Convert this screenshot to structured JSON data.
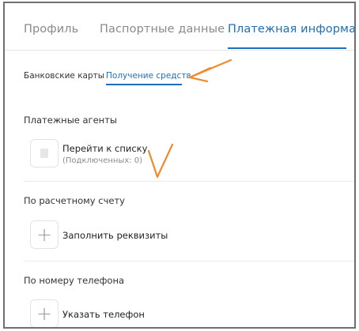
{
  "tabs": [
    {
      "label": "Профиль",
      "active": false
    },
    {
      "label": "Паспортные данные",
      "active": false
    },
    {
      "label": "Платежная информация",
      "active": true
    }
  ],
  "subtabs": [
    {
      "label": "Банковские карты",
      "active": false
    },
    {
      "label": "Получение средств",
      "active": true
    }
  ],
  "sections": {
    "agents": {
      "title": "Платежные агенты",
      "action": "Перейти к списку",
      "connected": "(Подключенных: 0)"
    },
    "account": {
      "title": "По расчетному счету",
      "action": "Заполнить реквизиты"
    },
    "phone": {
      "title": "По номеру телефона",
      "action": "Указать телефон"
    }
  },
  "colors": {
    "accent": "#1f6fb8",
    "annotation": "#f08a2c"
  },
  "icons": {
    "agents": "folder-icon",
    "account": "plus-icon",
    "phone": "plus-icon"
  }
}
